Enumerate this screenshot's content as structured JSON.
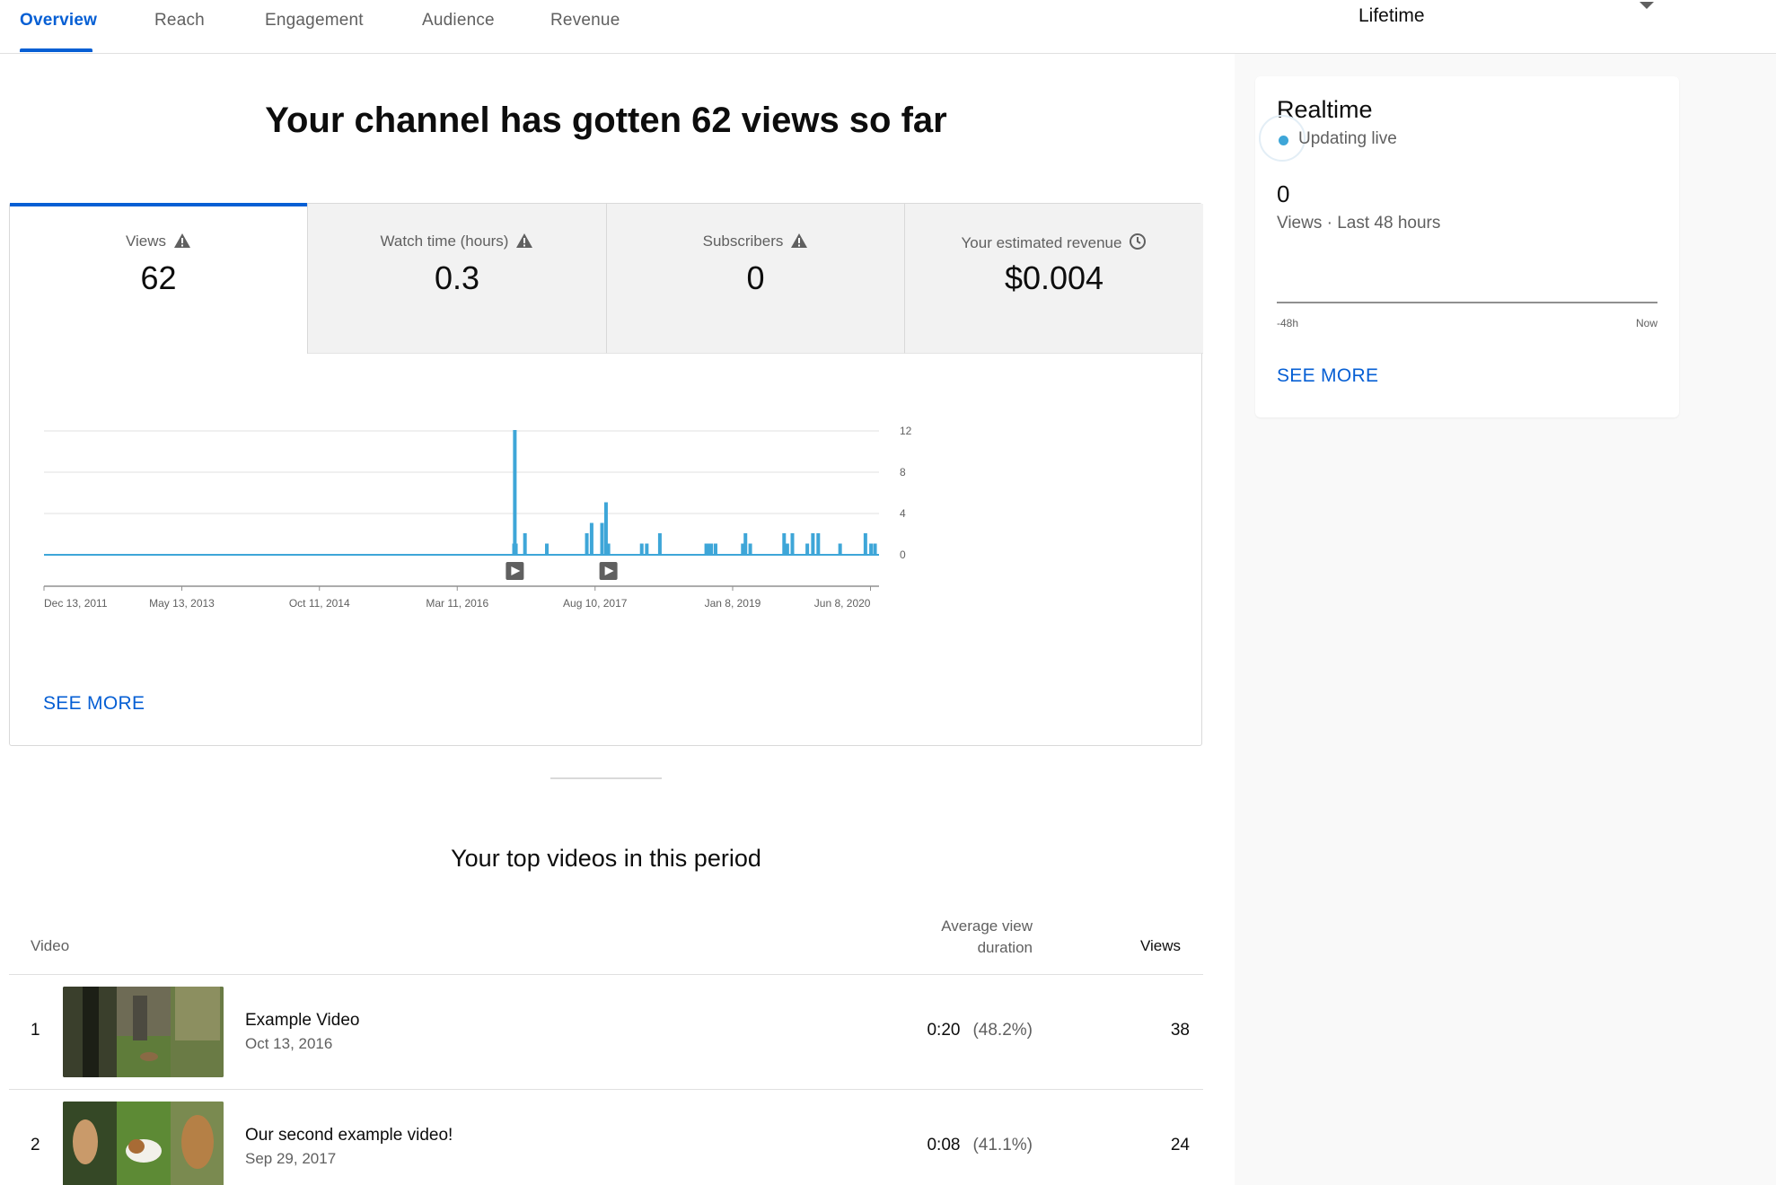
{
  "tabs": [
    {
      "label": "Overview",
      "active": true
    },
    {
      "label": "Reach",
      "active": false
    },
    {
      "label": "Engagement",
      "active": false
    },
    {
      "label": "Audience",
      "active": false
    },
    {
      "label": "Revenue",
      "active": false
    }
  ],
  "period": {
    "label": "Lifetime"
  },
  "headline": "Your channel has gotten 62 views so far",
  "metrics": [
    {
      "label": "Views",
      "value": "62",
      "icon": "warning-icon",
      "active": true
    },
    {
      "label": "Watch time (hours)",
      "value": "0.3",
      "icon": "warning-icon",
      "active": false
    },
    {
      "label": "Subscribers",
      "value": "0",
      "icon": "warning-icon",
      "active": false
    },
    {
      "label": "Your estimated revenue",
      "value": "$0.004",
      "icon": "clock-icon",
      "active": false
    }
  ],
  "chart_data": {
    "type": "line",
    "title": "",
    "xlabel": "",
    "ylabel": "",
    "x_range": [
      "2011-12-13",
      "2020-07-10"
    ],
    "ylim": [
      0,
      12
    ],
    "y_ticks": [
      "12",
      "8",
      "4",
      "0"
    ],
    "x_ticks": [
      "Dec 13, 2011",
      "May 13, 2013",
      "Oct 11, 2014",
      "Mar 11, 2016",
      "Aug 10, 2017",
      "Jan 8, 2019",
      "Jun 8, 2020"
    ],
    "series": [
      {
        "color": "#3ea6d8",
        "spikes": [
          {
            "date": "2016-10-10",
            "value": 1
          },
          {
            "date": "2016-10-13",
            "value": 12
          },
          {
            "date": "2016-10-17",
            "value": 1
          },
          {
            "date": "2016-11-20",
            "value": 2
          },
          {
            "date": "2017-02-10",
            "value": 1
          },
          {
            "date": "2017-07-10",
            "value": 2
          },
          {
            "date": "2017-07-28",
            "value": 3
          },
          {
            "date": "2017-09-05",
            "value": 3
          },
          {
            "date": "2017-09-20",
            "value": 5
          },
          {
            "date": "2017-09-29",
            "value": 1
          },
          {
            "date": "2018-02-01",
            "value": 1
          },
          {
            "date": "2018-02-20",
            "value": 1
          },
          {
            "date": "2018-04-10",
            "value": 2
          },
          {
            "date": "2018-10-01",
            "value": 1
          },
          {
            "date": "2018-10-10",
            "value": 1
          },
          {
            "date": "2018-10-20",
            "value": 1
          },
          {
            "date": "2018-11-05",
            "value": 1
          },
          {
            "date": "2019-02-15",
            "value": 1
          },
          {
            "date": "2019-02-25",
            "value": 2
          },
          {
            "date": "2019-03-15",
            "value": 1
          },
          {
            "date": "2019-07-20",
            "value": 2
          },
          {
            "date": "2019-08-01",
            "value": 1
          },
          {
            "date": "2019-08-20",
            "value": 2
          },
          {
            "date": "2019-10-15",
            "value": 1
          },
          {
            "date": "2019-11-05",
            "value": 2
          },
          {
            "date": "2019-11-25",
            "value": 2
          },
          {
            "date": "2020-02-15",
            "value": 1
          },
          {
            "date": "2020-05-20",
            "value": 2
          },
          {
            "date": "2020-06-10",
            "value": 1
          },
          {
            "date": "2020-06-25",
            "value": 1
          }
        ]
      }
    ],
    "video_markers": [
      "2016-10-13",
      "2017-09-29"
    ],
    "grid": true
  },
  "main_see_more": "SEE MORE",
  "top_videos": {
    "title": "Your top videos in this period",
    "headers": {
      "video": "Video",
      "avg_duration": "Average view duration",
      "views": "Views"
    },
    "rows": [
      {
        "rank": "1",
        "title": "Example Video",
        "date": "Oct 13, 2016",
        "duration": "0:20",
        "percent": "(48.2%)",
        "views": "38"
      },
      {
        "rank": "2",
        "title": "Our second example video!",
        "date": "Sep 29, 2017",
        "duration": "0:08",
        "percent": "(41.1%)",
        "views": "24"
      }
    ]
  },
  "realtime": {
    "title": "Realtime",
    "status": "Updating live",
    "value": "0",
    "label": "Views · Last 48 hours",
    "axis_left": "-48h",
    "axis_right": "Now",
    "see_more": "SEE MORE"
  },
  "colors": {
    "accent": "#065fd4",
    "chart_line": "#3ea6d8",
    "live_dot": "#3ea6d8"
  }
}
